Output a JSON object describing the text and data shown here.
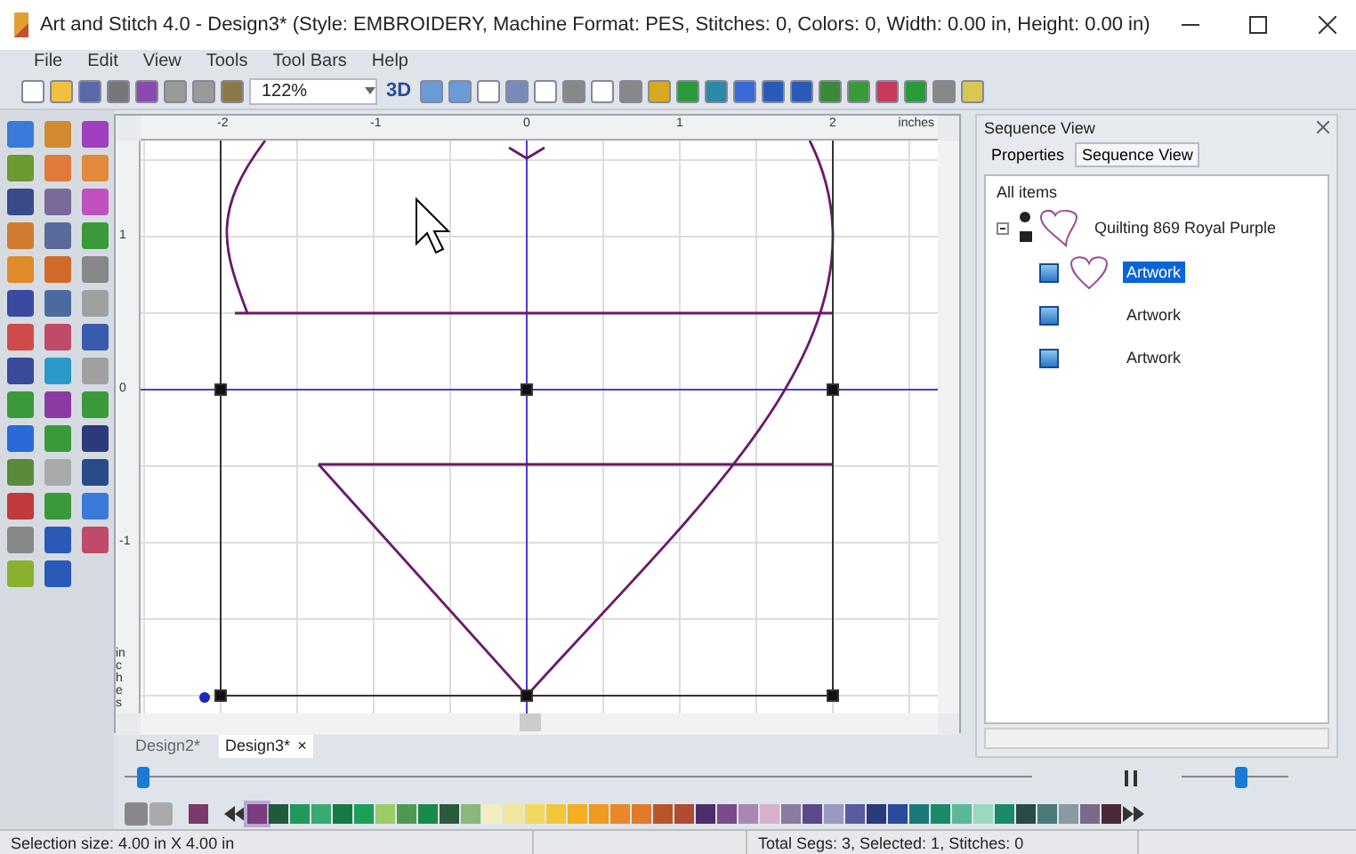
{
  "window": {
    "title": "Art and Stitch 4.0 - Design3* (Style: EMBROIDERY, Machine Format: PES, Stitches: 0, Colors: 0, Width: 0.00 in, Height: 0.00 in)"
  },
  "menu": [
    "File",
    "Edit",
    "View",
    "Tools",
    "Tool Bars",
    "Help"
  ],
  "toolbar": {
    "zoom": "122%",
    "view_3d": "3D"
  },
  "ruler": {
    "x_labels": [
      "-2",
      "-1",
      "0",
      "1",
      "2"
    ],
    "x_unit": "inches",
    "y_labels": [
      "1",
      "0",
      "-1"
    ],
    "y_unit": "inches"
  },
  "document_tabs": [
    {
      "label": "Design2*",
      "selected": false
    },
    {
      "label": "Design3*",
      "selected": true,
      "close": "×"
    }
  ],
  "playback": {
    "level": 0.02
  },
  "speed": {
    "level": 0.55
  },
  "palette": {
    "current": {
      "color": "#7a3a6a"
    },
    "colors": [
      {
        "color": "#7a3f7a",
        "selected": true
      },
      {
        "color": "#1f5a3c",
        "selected": false
      },
      {
        "color": "#1f9a5a",
        "selected": false
      },
      {
        "color": "#3aaa72",
        "selected": false
      },
      {
        "color": "#177a45",
        "selected": false
      },
      {
        "color": "#1aa058",
        "selected": false
      },
      {
        "color": "#9ccc6a",
        "selected": false
      },
      {
        "color": "#4f9a4f",
        "selected": false
      },
      {
        "color": "#1a8a4a",
        "selected": false
      },
      {
        "color": "#2a5a3a",
        "selected": false
      },
      {
        "color": "#8ab87a",
        "selected": false
      },
      {
        "color": "#f2eec0",
        "selected": false
      },
      {
        "color": "#f0e6a0",
        "selected": false
      },
      {
        "color": "#f2d860",
        "selected": false
      },
      {
        "color": "#f2c63a",
        "selected": false
      },
      {
        "color": "#f2b020",
        "selected": false
      },
      {
        "color": "#ee9a20",
        "selected": false
      },
      {
        "color": "#e8882a",
        "selected": false
      },
      {
        "color": "#e07a2a",
        "selected": false
      },
      {
        "color": "#b8562a",
        "selected": false
      },
      {
        "color": "#b04a30",
        "selected": false
      },
      {
        "color": "#4a2f6a",
        "selected": false
      },
      {
        "color": "#7a4a8a",
        "selected": false
      },
      {
        "color": "#a888b0",
        "selected": false
      },
      {
        "color": "#d8b0cc",
        "selected": false
      },
      {
        "color": "#8a7aa0",
        "selected": false
      },
      {
        "color": "#5a4a8a",
        "selected": false
      },
      {
        "color": "#9a98c0",
        "selected": false
      },
      {
        "color": "#5a5aa0",
        "selected": false
      },
      {
        "color": "#2a3a7a",
        "selected": false
      },
      {
        "color": "#2a4a9a",
        "selected": false
      },
      {
        "color": "#1a7a7a",
        "selected": false
      },
      {
        "color": "#1a8a6a",
        "selected": false
      },
      {
        "color": "#5ab89a",
        "selected": false
      },
      {
        "color": "#9ad8c0",
        "selected": false
      },
      {
        "color": "#1a8a6a",
        "selected": false
      },
      {
        "color": "#2a4a4a",
        "selected": false
      },
      {
        "color": "#4a7a7a",
        "selected": false
      },
      {
        "color": "#8a9aa0",
        "selected": false
      },
      {
        "color": "#7a6a8a",
        "selected": false
      },
      {
        "color": "#4a2a3a",
        "selected": false
      }
    ]
  },
  "panel": {
    "title": "Sequence View",
    "tabs": [
      {
        "label": "Properties",
        "selected": false
      },
      {
        "label": "Sequence View",
        "selected": true
      }
    ],
    "root": "All items",
    "items": [
      {
        "label": "Quilting 869 Royal Purple",
        "expanded": true,
        "children": [
          {
            "label": "Artwork",
            "selected": true
          },
          {
            "label": "Artwork",
            "selected": false
          },
          {
            "label": "Artwork",
            "selected": false
          }
        ]
      }
    ]
  },
  "status_bar": {
    "left": "Selection size: 4.00 in X 4.00 in",
    "right": "Total Segs: 3, Selected: 1, Stitches: 0"
  }
}
